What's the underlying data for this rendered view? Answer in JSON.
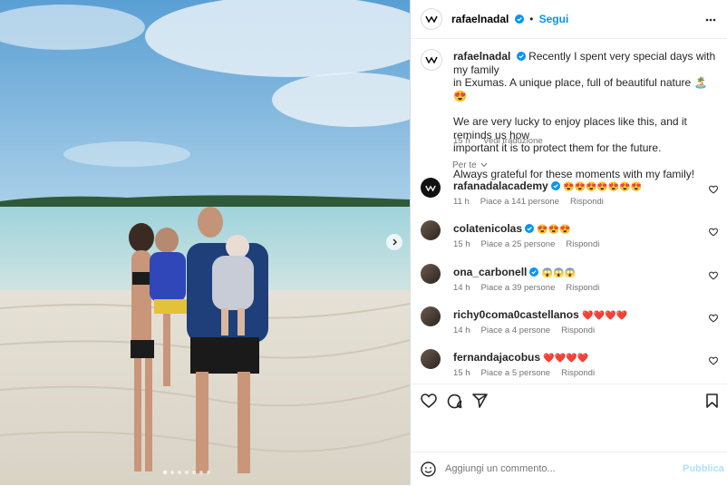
{
  "post": {
    "username": "rafaelnadal",
    "follow_label": "Segui",
    "dot": "•",
    "caption_line1": "Recently I spent very special days with my family",
    "caption_line2": "in Exumas. A unique place, full of beautiful nature 🏝️ 😍",
    "caption_p2_line1": "We are very lucky to enjoy places like this, and it reminds us how",
    "caption_p2_line2": "important it is to protect them for the future.",
    "caption_p3": "Always grateful for these moments with my family!",
    "time": "15 h",
    "translate_label": "Vedi traduzione",
    "for_you_label": "Per te"
  },
  "comments": [
    {
      "user": "rafanadalacademy",
      "verified": true,
      "text": "😍😍😍😍😍😍😍",
      "time": "11 h",
      "likes": "Piace a 141 persone",
      "reply": "Rispondi",
      "avatar": "academy-logo"
    },
    {
      "user": "colatenicolas",
      "verified": true,
      "text": "😍😍😍",
      "time": "15 h",
      "likes": "Piace a 25 persone",
      "reply": "Rispondi",
      "avatar": "user-photo"
    },
    {
      "user": "ona_carbonell",
      "verified": true,
      "text": "😱😱😱",
      "time": "14 h",
      "likes": "Piace a 39 persone",
      "reply": "Rispondi",
      "avatar": "user-photo"
    },
    {
      "user": "richy0coma0castellanos",
      "verified": false,
      "text": "❤️❤️❤️❤️",
      "time": "14 h",
      "likes": "Piace a 4 persone",
      "reply": "Rispondi",
      "avatar": "user-photo"
    },
    {
      "user": "fernandajacobus",
      "verified": false,
      "text": "❤️❤️❤️❤️",
      "time": "15 h",
      "likes": "Piace a 5 persone",
      "reply": "Rispondi",
      "avatar": "user-photo"
    }
  ],
  "composer": {
    "placeholder": "Aggiungi un commento...",
    "publish_label": "Pubblica"
  },
  "carousel": {
    "count": 7,
    "active": 0
  },
  "colors": {
    "accent": "#0095f6",
    "publish_disabled": "#b2dffc",
    "verified": "#0095f6"
  }
}
